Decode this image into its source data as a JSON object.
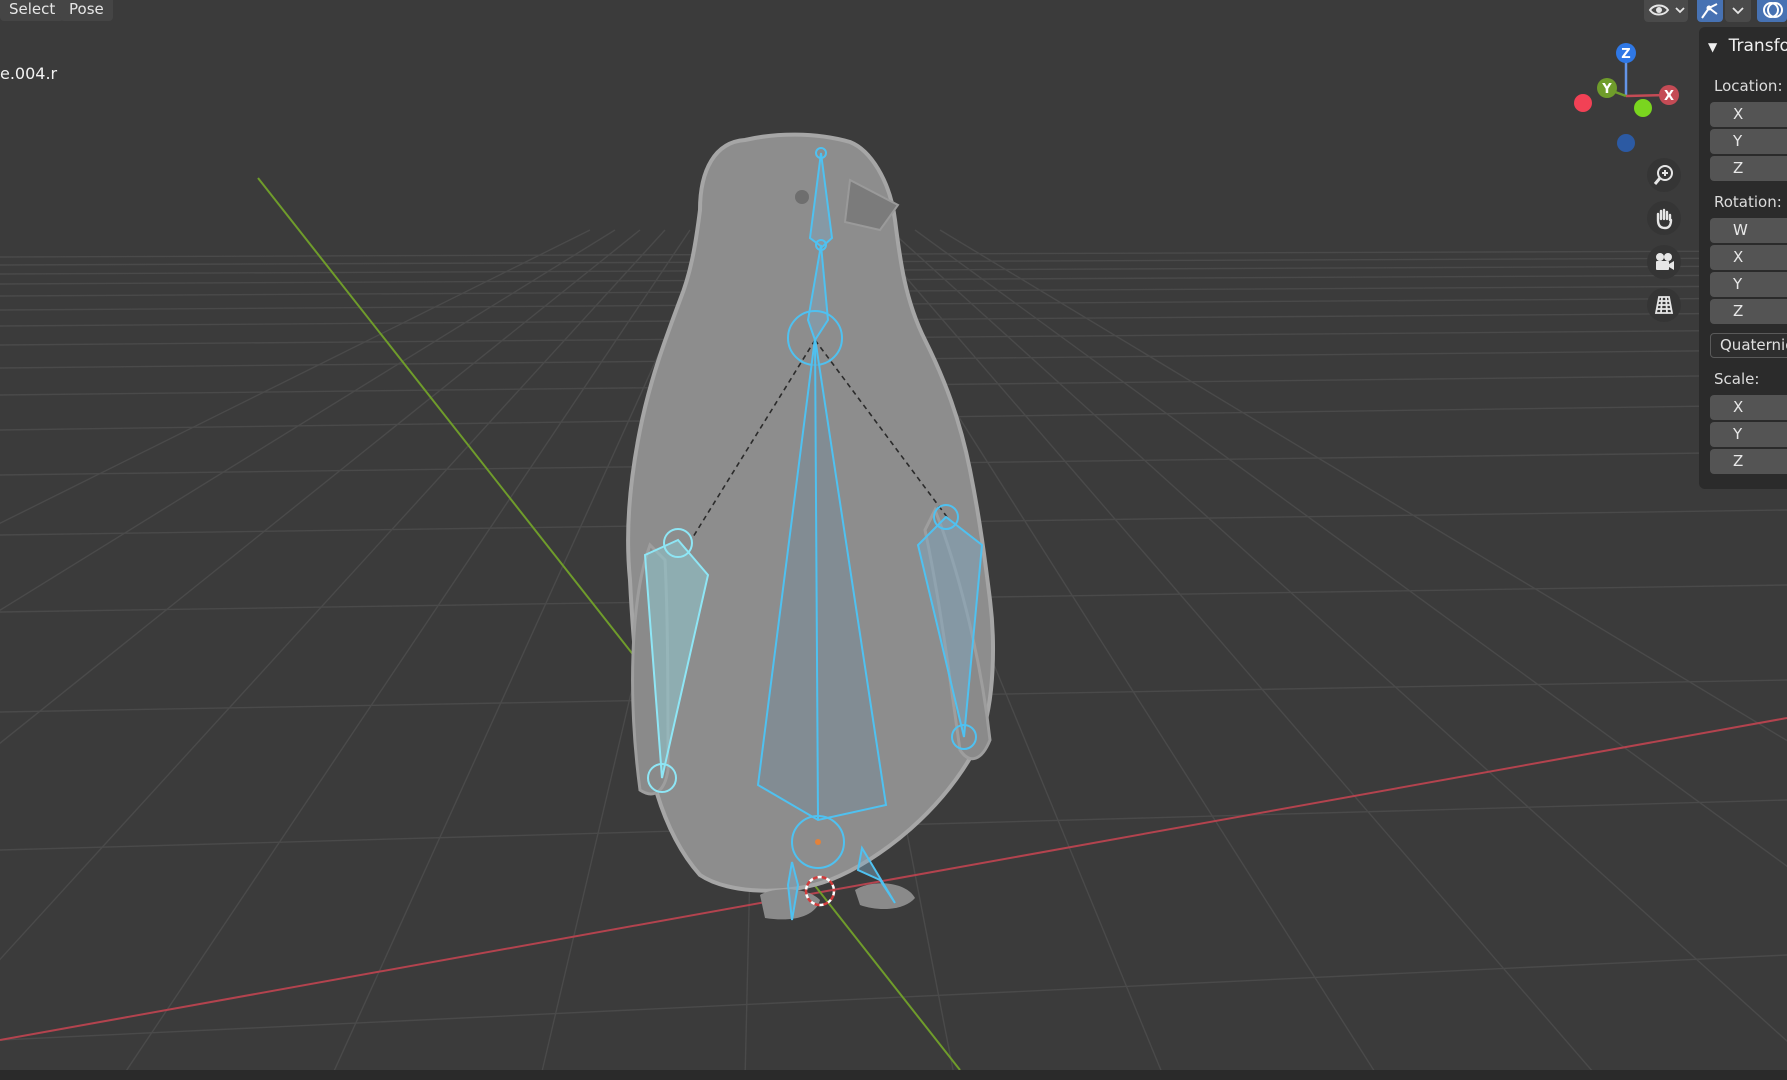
{
  "header": {
    "menus": [
      {
        "label": "Select"
      },
      {
        "label": "Pose"
      }
    ]
  },
  "viewport": {
    "active_bone_label": "e.004.r",
    "gizmo": {
      "z_label": "Z",
      "y_label": "Y",
      "x_label": "X"
    },
    "nav_buttons": [
      "zoom-icon",
      "hand-pan-icon",
      "camera-icon",
      "grid-ortho-icon"
    ],
    "colors": {
      "background": "#3b3b3b",
      "grid": "#4a4a4a",
      "x_axis": "#b3434e",
      "y_axis": "#6f9c2b",
      "bone": "#4fc1f0",
      "bone_selected": "#8ee6f5",
      "mesh": "#8f8f8f"
    }
  },
  "top_right_toolbar": {
    "icons": [
      "visibility-eye-icon",
      "dropdown-chevron-icon",
      "gizmo-toggle-icon",
      "dropdown-chevron-icon",
      "overlay-toggle-icon"
    ]
  },
  "npanel": {
    "section_title": "Transfo",
    "location": {
      "label": "Location:",
      "axes": [
        "X",
        "Y",
        "Z"
      ]
    },
    "rotation": {
      "label": "Rotation:",
      "axes": [
        "W",
        "X",
        "Y",
        "Z"
      ],
      "mode": "Quaternio"
    },
    "scale": {
      "label": "Scale:",
      "axes": [
        "X",
        "Y",
        "Z"
      ]
    }
  }
}
